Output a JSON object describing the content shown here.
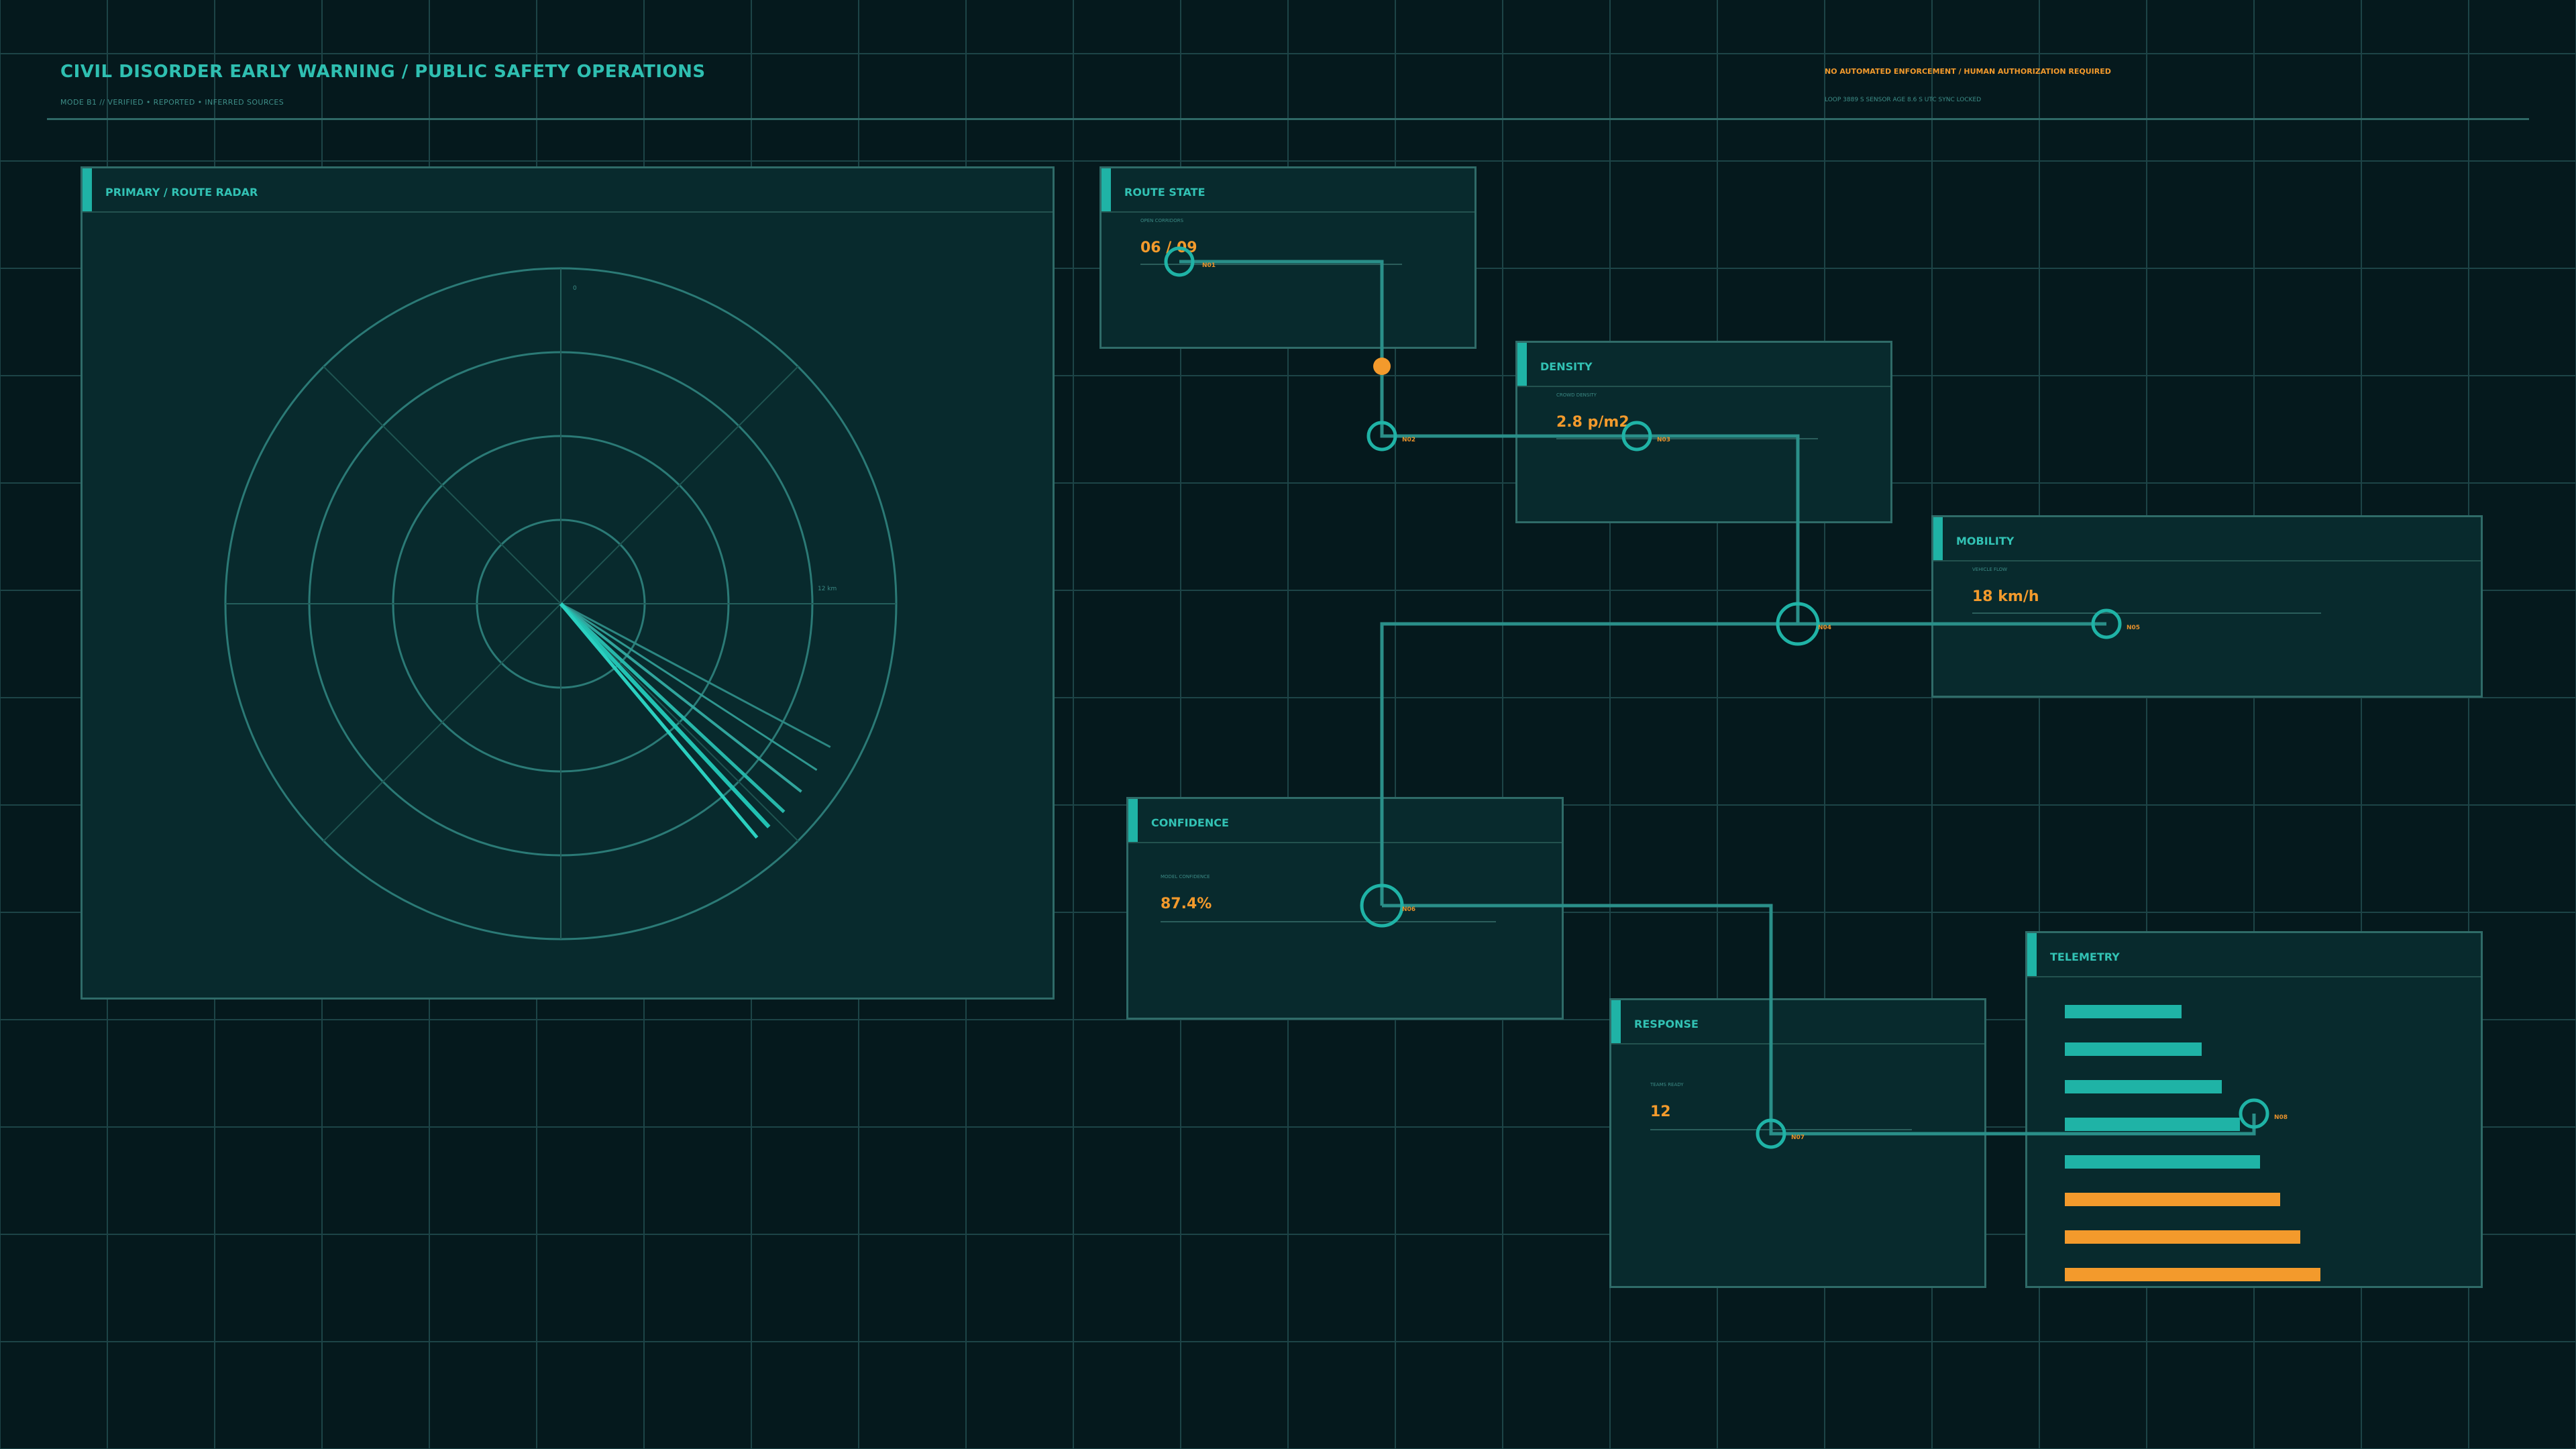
{
  "header": {
    "title": "CIVIL DISORDER EARLY WARNING / PUBLIC SAFETY OPERATIONS",
    "subtitle": "MODE B1  //  VERIFIED • REPORTED • INFERRED SOURCES",
    "warning": "NO AUTOMATED ENFORCEMENT / HUMAN AUTHORIZATION REQUIRED",
    "loop": "LOOP 3889 S  SENSOR AGE 8.6 S  UTC SYNC LOCKED"
  },
  "radar": {
    "title": "PRIMARY / ROUTE RADAR",
    "north_label": "0",
    "range_label": "12 km"
  },
  "panels": {
    "route_state": {
      "title": "ROUTE STATE",
      "label": "OPEN CORRIDORS",
      "value": "06 / 09"
    },
    "density": {
      "title": "DENSITY",
      "label": "CROWD DENSITY",
      "value": "2.8 p/m2"
    },
    "mobility": {
      "title": "MOBILITY",
      "label": "VEHICLE FLOW",
      "value": "18 km/h"
    },
    "confidence": {
      "title": "CONFIDENCE",
      "label": "MODEL CONFIDENCE",
      "value": "87.4%"
    },
    "response": {
      "title": "RESPONSE",
      "label": "TEAMS READY",
      "value": "12"
    },
    "telemetry": {
      "title": "TELEMETRY"
    }
  },
  "nodes": {
    "n1": "N01",
    "n2": "N02",
    "n3": "N03",
    "n4": "N04",
    "n5": "N05",
    "n6": "N06",
    "n7": "N07",
    "n8": "N08"
  },
  "telemetry_bars": {
    "values": [
      0.58,
      0.68,
      0.78,
      0.87,
      0.97,
      1.07,
      1.17,
      1.27
    ],
    "status": [
      "nominal",
      "nominal",
      "nominal",
      "nominal",
      "nominal",
      "alert",
      "alert",
      "alert"
    ]
  },
  "colors": {
    "teal": "#1fb3a6",
    "orange": "#f39a2c",
    "grid": "#1d4447",
    "background": "#05191d"
  }
}
